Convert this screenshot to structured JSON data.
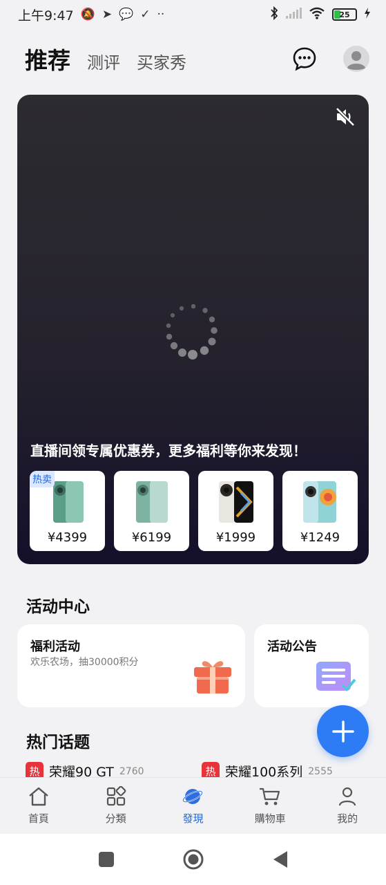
{
  "status_bar": {
    "time": "上午9:47",
    "more": "··",
    "battery": "25"
  },
  "header": {
    "tabs": [
      {
        "label": "推荐"
      },
      {
        "label": "测评"
      },
      {
        "label": "买家秀"
      }
    ]
  },
  "live": {
    "promo_text": "直播间领专属优惠券，更多福利等你来发现！",
    "products": [
      {
        "price": "¥4399",
        "tag": "热卖",
        "color": "#6fae9a"
      },
      {
        "price": "¥6199",
        "color": "#8fbcae"
      },
      {
        "price": "¥1999",
        "color": "#d9a83a"
      },
      {
        "price": "¥1249",
        "color": "#7ec2c8"
      }
    ]
  },
  "activity": {
    "title": "活动中心",
    "cards": [
      {
        "title": "福利活动",
        "subtitle": "欢乐农场，抽30000积分",
        "icon": "gift-icon"
      },
      {
        "title": "活动公告",
        "icon": "notice-icon"
      }
    ]
  },
  "topics": {
    "title": "热门话题",
    "items": [
      {
        "badge": "热",
        "name": "荣耀90 GT",
        "count": "2760"
      },
      {
        "badge": "热",
        "name": "荣耀100系列",
        "count": "2555"
      }
    ]
  },
  "bottom_nav": {
    "items": [
      {
        "label": "首頁",
        "icon": "home-icon"
      },
      {
        "label": "分類",
        "icon": "category-icon"
      },
      {
        "label": "發現",
        "icon": "discover-icon",
        "active": true
      },
      {
        "label": "購物車",
        "icon": "cart-icon"
      },
      {
        "label": "我的",
        "icon": "profile-icon"
      }
    ]
  },
  "colors": {
    "accent": "#2d7cf6",
    "hot_badge": "#e8333a"
  }
}
